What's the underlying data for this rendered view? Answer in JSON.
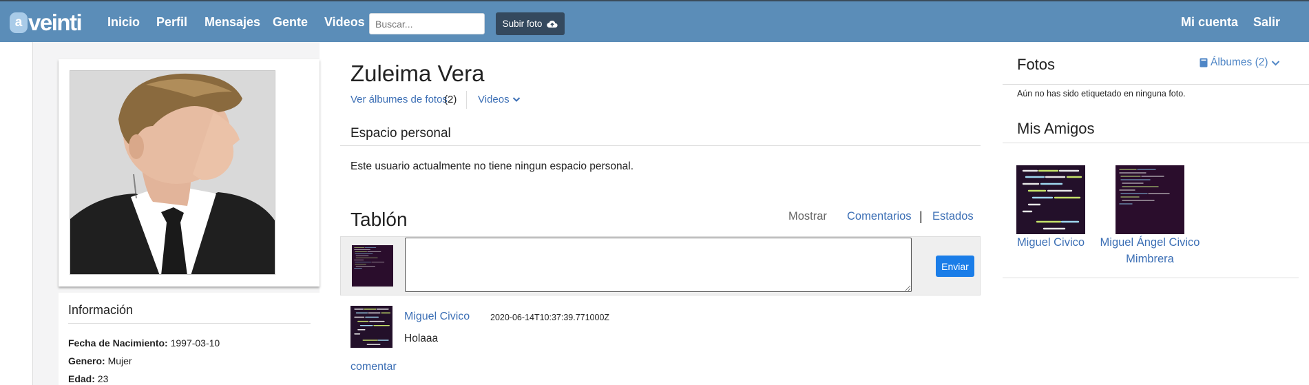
{
  "navbar": {
    "logo_letter": "a",
    "logo_text": "veinti",
    "links": [
      "Inicio",
      "Perfil",
      "Mensajes",
      "Gente",
      "Videos"
    ],
    "search_placeholder": "Buscar...",
    "upload_label": "Subir foto",
    "upload_icon": "cloud-upload-icon",
    "account_label": "Mi cuenta",
    "logout_label": "Salir"
  },
  "profile": {
    "name": "Zuleima Vera",
    "albums_link": "Ver álbumes de fotos",
    "albums_count": "(2)",
    "videos_link": "Videos",
    "info_title": "Información",
    "info": [
      {
        "label": "Fecha de Nacimiento:",
        "value": "1997-03-10"
      },
      {
        "label": "Genero:",
        "value": "Mujer"
      },
      {
        "label": "Edad:",
        "value": "23"
      }
    ]
  },
  "personal_space": {
    "title": "Espacio personal",
    "text": "Este usuario actualmente no tiene ningun espacio personal."
  },
  "board": {
    "title": "Tablón",
    "show_label": "Mostrar",
    "comments_label": "Comentarios",
    "separator": "|",
    "states_label": "Estados",
    "send_label": "Enviar",
    "post": {
      "author": "Miguel Civico",
      "timestamp": "2020-06-14T10:37:39.771000Z",
      "text": "Holaaa",
      "comment_label": "comentar"
    }
  },
  "sidebar": {
    "photos_title": "Fotos",
    "albums_label": "Álbumes (2)",
    "no_tags_text": "Aún no has sido etiquetado en ninguna foto.",
    "friends_title": "Mis Amigos",
    "friends": [
      {
        "name": "Miguel Civico"
      },
      {
        "name": "Miguel Ángel Civico Mimbrera"
      }
    ]
  },
  "colors": {
    "navbar": "#5b8db8",
    "link": "#3c6fb5",
    "send_button": "#1a7de8",
    "upload_button": "#34495e"
  }
}
